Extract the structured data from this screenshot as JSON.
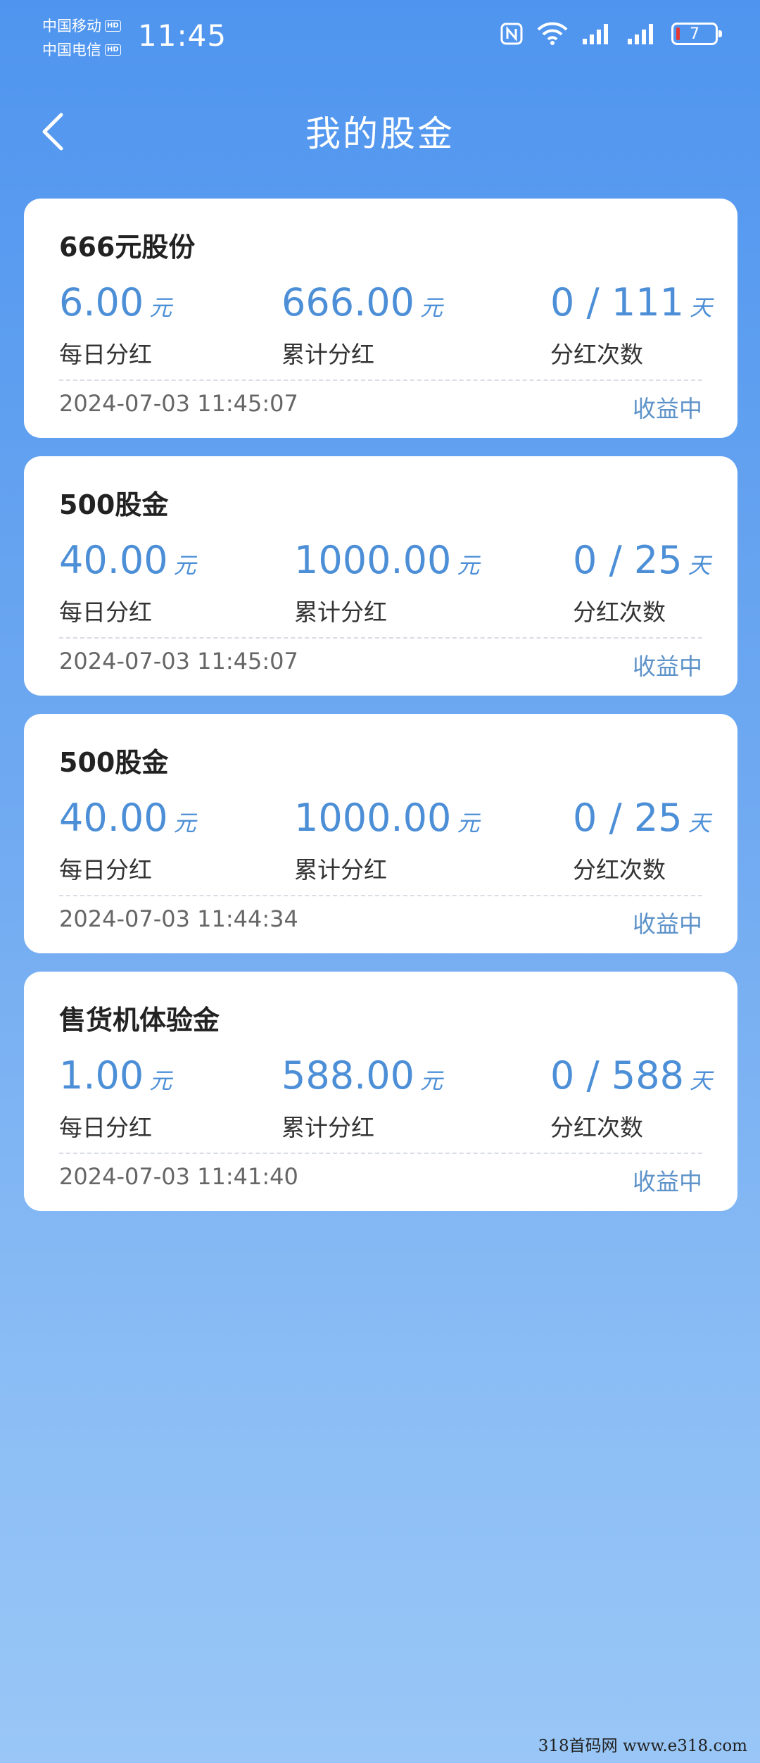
{
  "status_bar": {
    "carrier1": "中国移动",
    "carrier2": "中国电信",
    "hd": "HD",
    "time": "11:45",
    "battery": "7"
  },
  "nav": {
    "title": "我的股金"
  },
  "labels": {
    "daily": "每日分红",
    "total": "累计分红",
    "count": "分红次数",
    "yuan": "元",
    "day": "天"
  },
  "cards": [
    {
      "title": "666元股份",
      "daily": "6.00",
      "total": "666.00",
      "count": "0 / 111",
      "time": "2024-07-03 11:45:07",
      "status": "收益中"
    },
    {
      "title": "500股金",
      "daily": "40.00",
      "total": "1000.00",
      "count": "0 / 25",
      "time": "2024-07-03 11:45:07",
      "status": "收益中"
    },
    {
      "title": "500股金",
      "daily": "40.00",
      "total": "1000.00",
      "count": "0 / 25",
      "time": "2024-07-03 11:44:34",
      "status": "收益中"
    },
    {
      "title": "售货机体验金",
      "daily": "1.00",
      "total": "588.00",
      "count": "0 / 588",
      "time": "2024-07-03 11:41:40",
      "status": "收益中"
    }
  ],
  "watermark": "318首码网  www.e318.com",
  "colors": {
    "accent": "#4C8FD7",
    "bg_top": "#4F95EF",
    "bg_bottom": "#99C6F6"
  }
}
